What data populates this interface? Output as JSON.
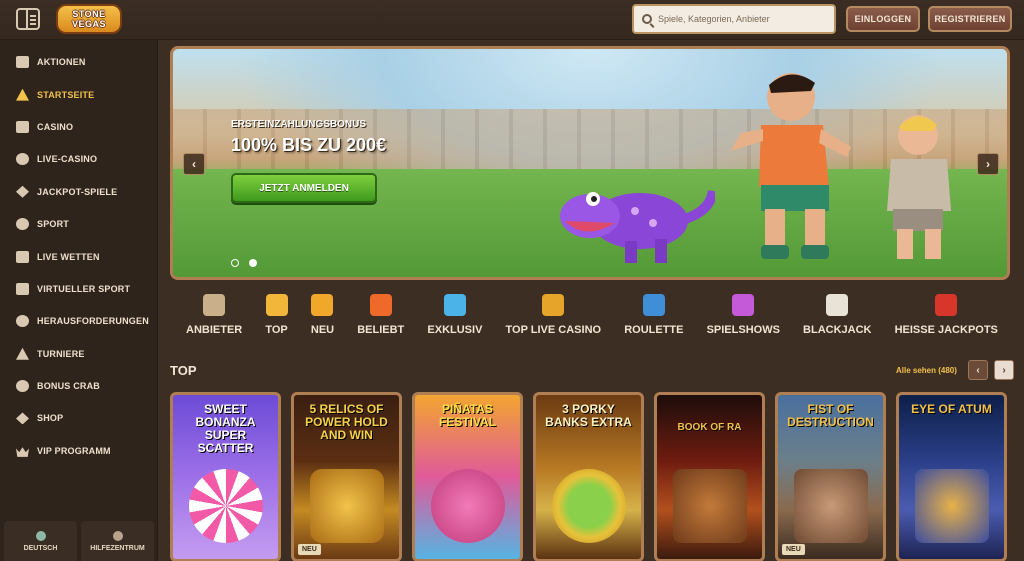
{
  "header": {
    "logo_line1": "STONE",
    "logo_line2": "VEGAS",
    "search_placeholder": "Spiele, Kategorien, Anbieter",
    "login_label": "EINLOGGEN",
    "register_label": "REGISTRIEREN"
  },
  "sidebar": {
    "items": [
      {
        "label": "AKTIONEN",
        "icon": "gift-icon"
      },
      {
        "label": "STARTSEITE",
        "icon": "home-icon"
      },
      {
        "label": "CASINO",
        "icon": "slot-machine-icon"
      },
      {
        "label": "LIVE-CASINO",
        "icon": "chip-icon"
      },
      {
        "label": "JACKPOT-SPIELE",
        "icon": "clover-icon"
      },
      {
        "label": "SPORT",
        "icon": "ball-icon"
      },
      {
        "label": "LIVE WETTEN",
        "icon": "live-icon"
      },
      {
        "label": "VIRTUELLER SPORT",
        "icon": "screen-icon"
      },
      {
        "label": "HERAUSFORDERUNGEN",
        "icon": "target-icon"
      },
      {
        "label": "TURNIERE",
        "icon": "trophy-icon"
      },
      {
        "label": "BONUS CRAB",
        "icon": "crab-icon"
      },
      {
        "label": "SHOP",
        "icon": "shop-icon"
      },
      {
        "label": "VIP PROGRAMM",
        "icon": "crown-icon"
      }
    ],
    "active_index": 1,
    "footer": {
      "language_label": "DEUTSCH",
      "help_label": "HILFEZENTRUM"
    }
  },
  "hero": {
    "subtitle": "ERSTEINZAHLUNGSBONUS",
    "title": "100% BIS ZU 200€",
    "cta": "JETZT ANMELDEN",
    "prev_arrow": "‹",
    "next_arrow": "›",
    "slides": 2,
    "active_slide": 2
  },
  "categories": [
    {
      "label": "ANBIETER",
      "color": "#c9b08a"
    },
    {
      "label": "TOP",
      "color": "#f2b63a"
    },
    {
      "label": "NEU",
      "color": "#f0a72a"
    },
    {
      "label": "BELIEBT",
      "color": "#ef6a2a"
    },
    {
      "label": "EXKLUSIV",
      "color": "#4cb3e8"
    },
    {
      "label": "TOP LIVE CASINO",
      "color": "#e6a52a"
    },
    {
      "label": "ROULETTE",
      "color": "#3f8ed8"
    },
    {
      "label": "SPIELSHOWS",
      "color": "#c45ad8"
    },
    {
      "label": "BLACKJACK",
      "color": "#e9e2d6"
    },
    {
      "label": "HEISSE JACKPOTS",
      "color": "#d8362a"
    }
  ],
  "top_section": {
    "title": "TOP",
    "see_all": "Alle sehen (480)",
    "prev": "‹",
    "next": "›",
    "games": [
      {
        "title": "SWEET BONANZA SUPER SCATTER",
        "badge": ""
      },
      {
        "title": "5 RELICS OF POWER HOLD AND WIN",
        "badge": "NEU"
      },
      {
        "title": "PIÑATAS FESTIVAL",
        "badge": ""
      },
      {
        "title": "3 PORKY BANKS EXTRA",
        "badge": ""
      },
      {
        "title": "BOOK OF RA",
        "badge": ""
      },
      {
        "title": "FIST OF DESTRUCTION",
        "badge": "NEU"
      },
      {
        "title": "EYE OF ATUM",
        "badge": ""
      }
    ]
  }
}
